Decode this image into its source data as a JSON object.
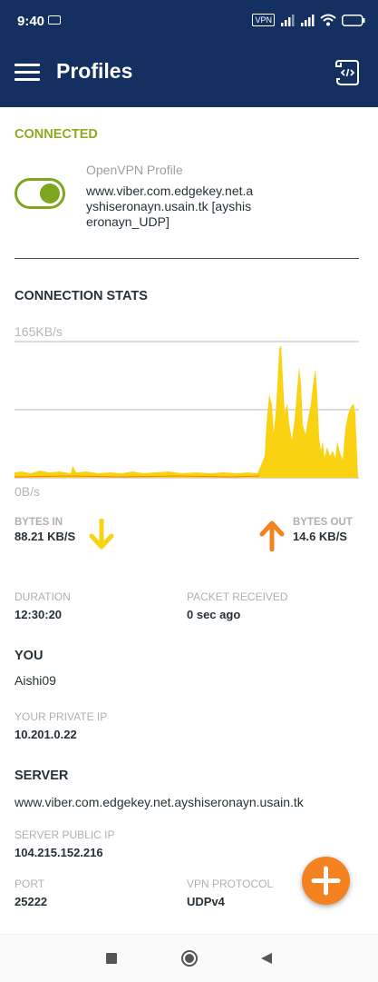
{
  "status_bar": {
    "time": "9:40",
    "vpn_badge": "VPN"
  },
  "toolbar": {
    "title": "Profiles",
    "menu_icon": "menu-icon",
    "action_icon": "document-code-icon"
  },
  "connection": {
    "status": "CONNECTED",
    "toggle_on": true,
    "profile_caption": "OpenVPN Profile",
    "profile_name": "www.viber.com.edgekey.net.ayshiseronayn.usain.tk [ayshiseronayn_UDP]"
  },
  "stats": {
    "heading": "CONNECTION STATS",
    "max_label": "165KB/s",
    "min_label": "0B/s",
    "bytes_in_label": "BYTES IN",
    "bytes_in_value": "88.21 KB/S",
    "bytes_out_label": "BYTES OUT",
    "bytes_out_value": "14.6 KB/S",
    "colors": {
      "in": "#f9d311",
      "out": "#f58220"
    }
  },
  "session": {
    "duration_label": "DURATION",
    "duration_value": "12:30:20",
    "packet_label": "PACKET RECEIVED",
    "packet_value": "0 sec ago"
  },
  "you": {
    "heading": "YOU",
    "username": "Aishi09",
    "private_ip_label": "YOUR PRIVATE IP",
    "private_ip_value": "10.201.0.22"
  },
  "server": {
    "heading": "SERVER",
    "host": "www.viber.com.edgekey.net.ayshiseronayn.usain.tk",
    "public_ip_label": "SERVER PUBLIC IP",
    "public_ip_value": "104.215.152.216",
    "port_label": "PORT",
    "port_value": "25222",
    "protocol_label": "VPN PROTOCOL",
    "protocol_value": "UDPv4"
  },
  "fab": {
    "icon": "plus-icon",
    "color": "#f58220"
  },
  "nav": {
    "recents": "square-icon",
    "home": "circle-icon",
    "back": "back-triangle-icon"
  }
}
